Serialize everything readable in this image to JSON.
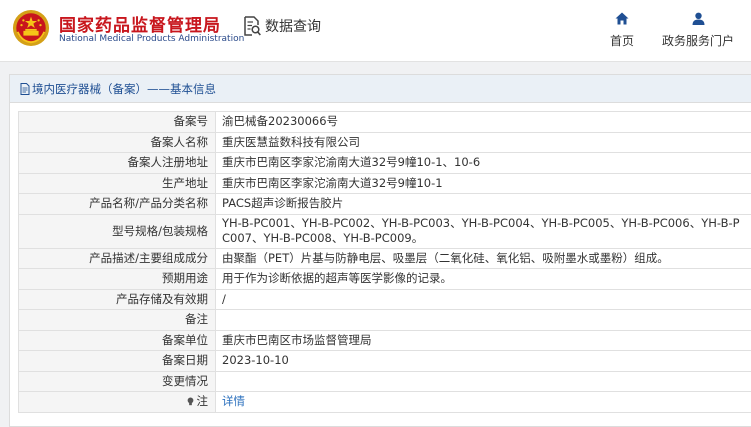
{
  "header": {
    "org_name_cn": "国家药品监督管理局",
    "org_name_en": "National Medical Products Administration",
    "query_label": "数据查询",
    "nav": {
      "home": "首页",
      "portal": "政务服务门户"
    }
  },
  "panel": {
    "title": "境内医疗器械（备案）——基本信息",
    "rows": [
      {
        "label": "备案号",
        "value": "渝巴械备20230066号"
      },
      {
        "label": "备案人名称",
        "value": "重庆医慧益数科技有限公司"
      },
      {
        "label": "备案人注册地址",
        "value": "重庆市巴南区李家沱渝南大道32号9幢10-1、10-6"
      },
      {
        "label": "生产地址",
        "value": "重庆市巴南区李家沱渝南大道32号9幢10-1"
      },
      {
        "label": "产品名称/产品分类名称",
        "value": "PACS超声诊断报告胶片"
      },
      {
        "label": "型号规格/包装规格",
        "value": "YH-B-PC001、YH-B-PC002、YH-B-PC003、YH-B-PC004、YH-B-PC005、YH-B-PC006、YH-B-PC007、YH-B-PC008、YH-B-PC009。"
      },
      {
        "label": "产品描述/主要组成成分",
        "value": "由聚酯（PET）片基与防静电层、吸墨层（二氧化硅、氧化铝、吸附墨水或墨粉）组成。"
      },
      {
        "label": "预期用途",
        "value": "用于作为诊断依据的超声等医学影像的记录。"
      },
      {
        "label": "产品存储及有效期",
        "value": "/"
      },
      {
        "label": "备注",
        "value": ""
      },
      {
        "label": "备案单位",
        "value": "重庆市巴南区市场监督管理局"
      },
      {
        "label": "备案日期",
        "value": "2023-10-10"
      },
      {
        "label": "变更情况",
        "value": ""
      }
    ],
    "note": {
      "label": "注",
      "link": "详情",
      "icon": "lightbulb-icon"
    }
  },
  "colors": {
    "brand_red": "#c8161d",
    "brand_blue": "#1f4f93",
    "link_blue": "#2a6fbd",
    "panel_header_bg": "#eaf0f6",
    "label_cell_bg": "#f5f5f5",
    "page_bg": "#f0f1f3"
  }
}
